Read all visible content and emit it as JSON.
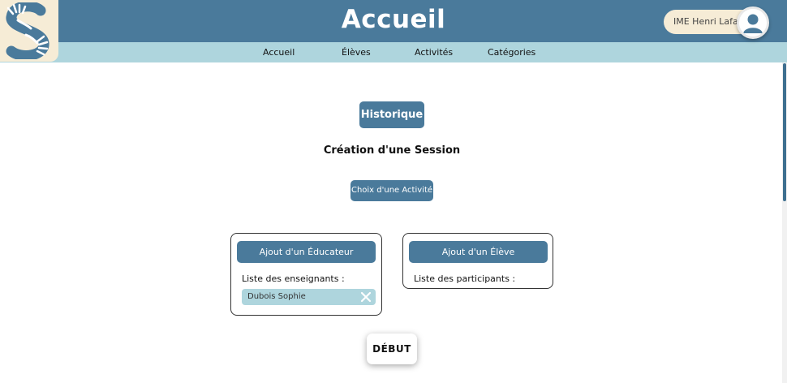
{
  "header": {
    "title": "Accueil",
    "user_name": "IME Henri Lafay"
  },
  "nav": {
    "items": [
      {
        "label": "Accueil"
      },
      {
        "label": "Élèves"
      },
      {
        "label": "Activités"
      },
      {
        "label": "Catégories"
      }
    ]
  },
  "main": {
    "history_button": "Historique",
    "section_title": "Création d'une Session",
    "activity_button": "Choix d'une Activité",
    "educator_card": {
      "button": "Ajout d'un Éducateur",
      "list_label": "Liste des enseignants :",
      "chips": [
        {
          "name": "Dubois Sophie"
        }
      ]
    },
    "student_card": {
      "button": "Ajout d'un Élève",
      "list_label": "Liste des participants :"
    },
    "start_button": "DÉBUT"
  },
  "icons": {
    "logo": "hands-s-logo-icon",
    "avatar": "user-avatar-icon",
    "chip_close": "close-icon"
  },
  "colors": {
    "primary": "#4a7a9b",
    "nav_bg": "#aed5dd",
    "logo_bg": "#f6ecd6",
    "chip_bg": "#aed5dd"
  }
}
